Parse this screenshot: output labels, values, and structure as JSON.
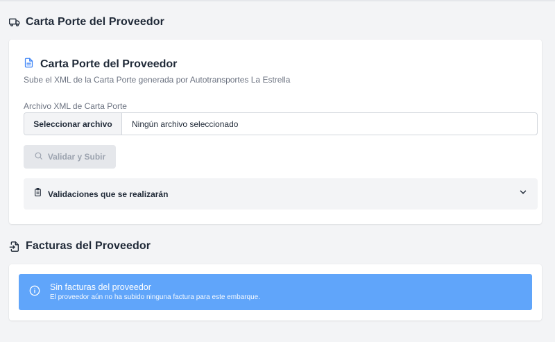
{
  "carta_porte_section": {
    "heading": "Carta Porte del Proveedor",
    "heading_icon": "truck-icon",
    "card": {
      "title": "Carta Porte del Proveedor",
      "title_icon": "document-icon",
      "subtitle": "Sube el XML de la Carta Porte generada por Autotransportes La Estrella",
      "file_field": {
        "label": "Archivo XML de Carta Porte",
        "button_label": "Seleccionar archivo",
        "value": "Ningún archivo seleccionado"
      },
      "validate_button": {
        "label": "Validar y Subir",
        "icon": "search-icon",
        "disabled": true
      },
      "validations_accordion": {
        "label": "Validaciones que se realizarán",
        "icon": "clipboard-icon",
        "chevron": "chevron-down-icon"
      }
    }
  },
  "facturas_section": {
    "heading": "Facturas del Proveedor",
    "heading_icon": "file-import-icon",
    "alert": {
      "icon": "info-icon",
      "title": "Sin facturas del proveedor",
      "message": "El proveedor aún no ha subido ninguna factura para este embarque."
    }
  },
  "colors": {
    "accent": "#3b82f6",
    "alert_bg": "#60a5fa",
    "page_bg": "#f3f4f6"
  }
}
